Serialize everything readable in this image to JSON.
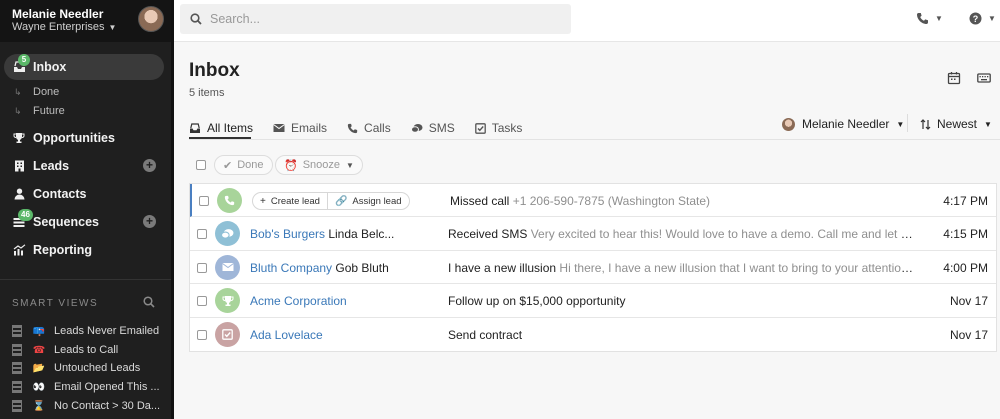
{
  "user": {
    "name": "Melanie Needler",
    "org": "Wayne Enterprises"
  },
  "sidebar": {
    "items": [
      {
        "label": "Inbox",
        "badge": "5",
        "icon": "inbox-icon"
      },
      {
        "label": "Opportunities",
        "icon": "trophy-icon"
      },
      {
        "label": "Leads",
        "icon": "building-icon"
      },
      {
        "label": "Contacts",
        "icon": "person-icon"
      },
      {
        "label": "Sequences",
        "badge": "46",
        "icon": "sequences-icon"
      },
      {
        "label": "Reporting",
        "icon": "chart-icon"
      }
    ],
    "subitems": [
      "Done",
      "Future"
    ],
    "smart_views_title": "SMART VIEWS",
    "smart_views": [
      {
        "label": "Leads Never Emailed",
        "emoji": "📪"
      },
      {
        "label": "Leads to Call",
        "emoji": "☎"
      },
      {
        "label": "Untouched Leads",
        "emoji": "📂"
      },
      {
        "label": "Email Opened This ...",
        "emoji": "👀"
      },
      {
        "label": "No Contact > 30 Da...",
        "emoji": "⌛"
      }
    ]
  },
  "search": {
    "placeholder": "Search..."
  },
  "page": {
    "title": "Inbox",
    "count": "5 items"
  },
  "tabs": [
    "All Items",
    "Emails",
    "Calls",
    "SMS",
    "Tasks"
  ],
  "filter": {
    "user": "Melanie Needler",
    "sort": "Newest"
  },
  "bulk": {
    "done": "Done",
    "snooze": "Snooze"
  },
  "rows": [
    {
      "type": "call",
      "avatar_color": "#a8d49a",
      "actions": [
        "Create lead",
        "Assign lead"
      ],
      "desc_main": "Missed call",
      "desc_sub": "+1 206-590-7875 (Washington State)",
      "time": "4:17 PM"
    },
    {
      "type": "sms",
      "avatar_color": "#8fc0d6",
      "lead": "Bob's Burgers",
      "contact": "Linda Belc...",
      "desc_main": "Received SMS",
      "desc_sub": "Very excited to hear this! Would love to have a demo. Call me and let me kno...",
      "time": "4:15 PM"
    },
    {
      "type": "email",
      "avatar_color": "#9fb6d8",
      "lead": "Bluth Company",
      "contact": "Gob Bluth",
      "desc_main": "I have a new illusion",
      "desc_sub": "Hi there, I have a new illusion that I want to bring to your attention. Can...",
      "time": "4:00 PM"
    },
    {
      "type": "opportunity",
      "avatar_color": "#a8d49a",
      "lead": "Acme Corporation",
      "contact": "",
      "desc_main": "Follow up on $15,000 opportunity",
      "desc_sub": "",
      "time": "Nov 17"
    },
    {
      "type": "task",
      "avatar_color": "#c9a3a3",
      "lead": "Ada Lovelace",
      "contact": "",
      "desc_main": "Send contract",
      "desc_sub": "",
      "time": "Nov 17"
    }
  ]
}
